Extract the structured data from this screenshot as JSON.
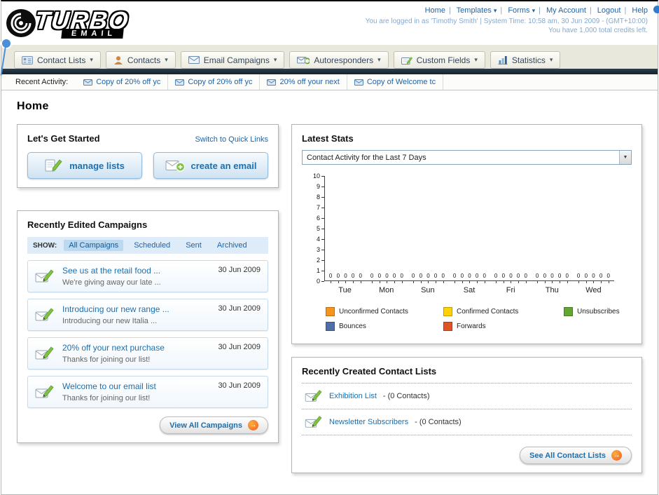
{
  "header": {
    "logo_title": "TURBO",
    "logo_subtitle": "EMAIL",
    "links": [
      {
        "label": "Home",
        "dropdown": false
      },
      {
        "label": "Templates",
        "dropdown": true
      },
      {
        "label": "Forms",
        "dropdown": true
      },
      {
        "label": "My Account",
        "dropdown": false
      },
      {
        "label": "Logout",
        "dropdown": false
      },
      {
        "label": "Help",
        "dropdown": false
      }
    ],
    "login_info": "You are logged in as 'Timothy Smith' | System Time: 10:58 am, 30 Jun 2009 - (GMT+10:00)",
    "credits": "You have 1,000 total credits left."
  },
  "nav": {
    "items": [
      {
        "label": "Contact Lists"
      },
      {
        "label": "Contacts"
      },
      {
        "label": "Email Campaigns"
      },
      {
        "label": "Autoresponders"
      },
      {
        "label": "Custom Fields"
      },
      {
        "label": "Statistics"
      }
    ]
  },
  "recent_activity": {
    "label": "Recent Activity:",
    "items": [
      {
        "label": "Copy of 20% off yc"
      },
      {
        "label": "Copy of 20% off yc"
      },
      {
        "label": "20% off your next"
      },
      {
        "label": "Copy of Welcome tc"
      }
    ]
  },
  "page": {
    "title": "Home"
  },
  "get_started": {
    "title": "Let's Get Started",
    "switch_link": "Switch to Quick Links",
    "manage_lists_label": "manage lists",
    "create_email_label": "create an email"
  },
  "campaigns": {
    "title": "Recently Edited Campaigns",
    "show_label": "SHOW:",
    "tabs": [
      {
        "label": "All Campaigns",
        "selected": true
      },
      {
        "label": "Scheduled",
        "selected": false
      },
      {
        "label": "Sent",
        "selected": false
      },
      {
        "label": "Archived",
        "selected": false
      }
    ],
    "items": [
      {
        "title": "See us at the retail food ...",
        "subtitle": "We're giving away our late ...",
        "date": "30 Jun 2009"
      },
      {
        "title": "Introducing our new range ...",
        "subtitle": "Introducing our new Italia ...",
        "date": "30 Jun 2009"
      },
      {
        "title": "20% off your next purchase",
        "subtitle": "Thanks for joining our list!",
        "date": "30 Jun 2009"
      },
      {
        "title": "Welcome to our email list",
        "subtitle": "Thanks for joining our list!",
        "date": "30 Jun 2009"
      }
    ],
    "view_all_label": "View All Campaigns"
  },
  "stats": {
    "title": "Latest Stats",
    "selector_value": "Contact Activity for the Last 7 Days",
    "chart_data": {
      "type": "bar",
      "title": "Contact Activity for the Last 7 Days",
      "categories": [
        "Tue",
        "Mon",
        "Sun",
        "Sat",
        "Fri",
        "Thu",
        "Wed"
      ],
      "series": [
        {
          "name": "Unconfirmed Contacts",
          "color": "#F7941E",
          "values": [
            0,
            0,
            0,
            0,
            0,
            0,
            0
          ]
        },
        {
          "name": "Confirmed Contacts",
          "color": "#FFD200",
          "values": [
            0,
            0,
            0,
            0,
            0,
            0,
            0
          ]
        },
        {
          "name": "Unsubscribes",
          "color": "#61A62F",
          "values": [
            0,
            0,
            0,
            0,
            0,
            0,
            0
          ]
        },
        {
          "name": "Bounces",
          "color": "#4F6FA8",
          "values": [
            0,
            0,
            0,
            0,
            0,
            0,
            0
          ]
        },
        {
          "name": "Forwards",
          "color": "#E25328",
          "values": [
            0,
            0,
            0,
            0,
            0,
            0,
            0
          ]
        }
      ],
      "ylim": [
        0,
        10
      ],
      "yticks": [
        0,
        1,
        2,
        3,
        4,
        5,
        6,
        7,
        8,
        9,
        10
      ],
      "grid": false,
      "legend_position": "bottom"
    }
  },
  "contact_lists": {
    "title": "Recently Created Contact Lists",
    "items": [
      {
        "name": "Exhibition List",
        "suffix": "- (0 Contacts)"
      },
      {
        "name": "Newsletter Subscribers",
        "suffix": "- (0 Contacts)"
      }
    ],
    "see_all_label": "See All Contact Lists"
  },
  "colors": {
    "accent_blue": "#1d6fad",
    "dark_bar": "#20303c",
    "orange": "#F7941E"
  }
}
